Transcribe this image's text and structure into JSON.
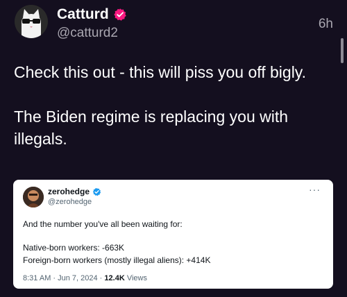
{
  "tweet": {
    "author": {
      "display_name": "Catturd",
      "handle": "@catturd2",
      "avatar_icon": "cat-with-sunglasses-avatar",
      "verified_icon": "verified-badge-icon",
      "verified_color": "#f91880"
    },
    "time": "6h",
    "text": "Check this out - this will piss you off bigly.\n\nThe Biden regime is replacing you with illegals."
  },
  "quoted_tweet": {
    "author": {
      "display_name": "zerohedge",
      "handle": "@zerohedge",
      "avatar_icon": "zerohedge-avatar",
      "verified_icon": "verified-badge-icon",
      "verified_color": "#1d9bf0"
    },
    "more_label": "···",
    "text_line_1": "And the number you've all been waiting for:",
    "text_line_2": "Native-born workers: -663K",
    "text_line_3": "Foreign-born workers (mostly illegal aliens): +414K",
    "timestamp": "8:31 AM · Jun 7, 2024 · ",
    "views_count": "12.4K",
    "views_label": " Views"
  },
  "colors": {
    "background": "#140f1f",
    "secondary_text": "#a9a6b0",
    "card_background": "#ffffff"
  }
}
